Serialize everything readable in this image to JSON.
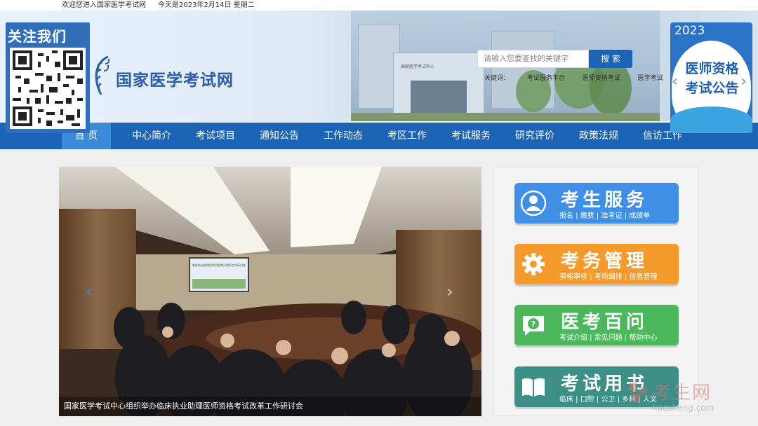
{
  "topbar": {
    "welcome": "欢迎您进入国家医学考试网",
    "date": "今天是2023年2月14日  星期二"
  },
  "header": {
    "logo_text": "国家医学考试网",
    "search": {
      "placeholder": "请输入您要查找的关键字",
      "button": "搜 索"
    },
    "keywords_label": "关键词：",
    "keywords": [
      "考试服务平台",
      "医师资格考试",
      "医学考试"
    ],
    "building_sign": "国家医学考试中心"
  },
  "qr_float": {
    "title": "关注我们"
  },
  "ad_float": {
    "year": "2023",
    "line1": "医师资格",
    "line2": "考试公告"
  },
  "nav": {
    "items": [
      "首 页",
      "中心简介",
      "考试项目",
      "通知公告",
      "工作动态",
      "考区工作",
      "考试服务",
      "研究评价",
      "政策法规",
      "信访工作"
    ],
    "active_index": 0
  },
  "slider": {
    "caption": "国家医学考试中心组织举办临床执业助理医师资格考试改革工作研讨会",
    "screen_text": "临床执业助理医师资格考试改革工作研讨会"
  },
  "services": [
    {
      "title": "考生服务",
      "links": "报名 | 缴费 | 准考证 | 成绩单",
      "icon": "user-icon",
      "color": "#3f8fe6"
    },
    {
      "title": "考务管理",
      "links": "资格审核 | 考场编排 | 信息管理",
      "icon": "gear-icon",
      "color": "#f39a2a"
    },
    {
      "title": "医考百问",
      "links": "考试介绍 | 常见问题 | 帮助中心",
      "icon": "question-icon",
      "color": "#4cb85c"
    },
    {
      "title": "考试用书",
      "links": "临床 | 口腔 | 公卫 | 乡村 | 人文",
      "icon": "book-icon",
      "color": "#3c8f86"
    }
  ],
  "watermark": {
    "cn": "考生网",
    "en": "kaosheng.com"
  },
  "colors": {
    "nav": "#1b63b5",
    "nav_active": "#3b8ad8",
    "logo": "#2a5ea8"
  }
}
